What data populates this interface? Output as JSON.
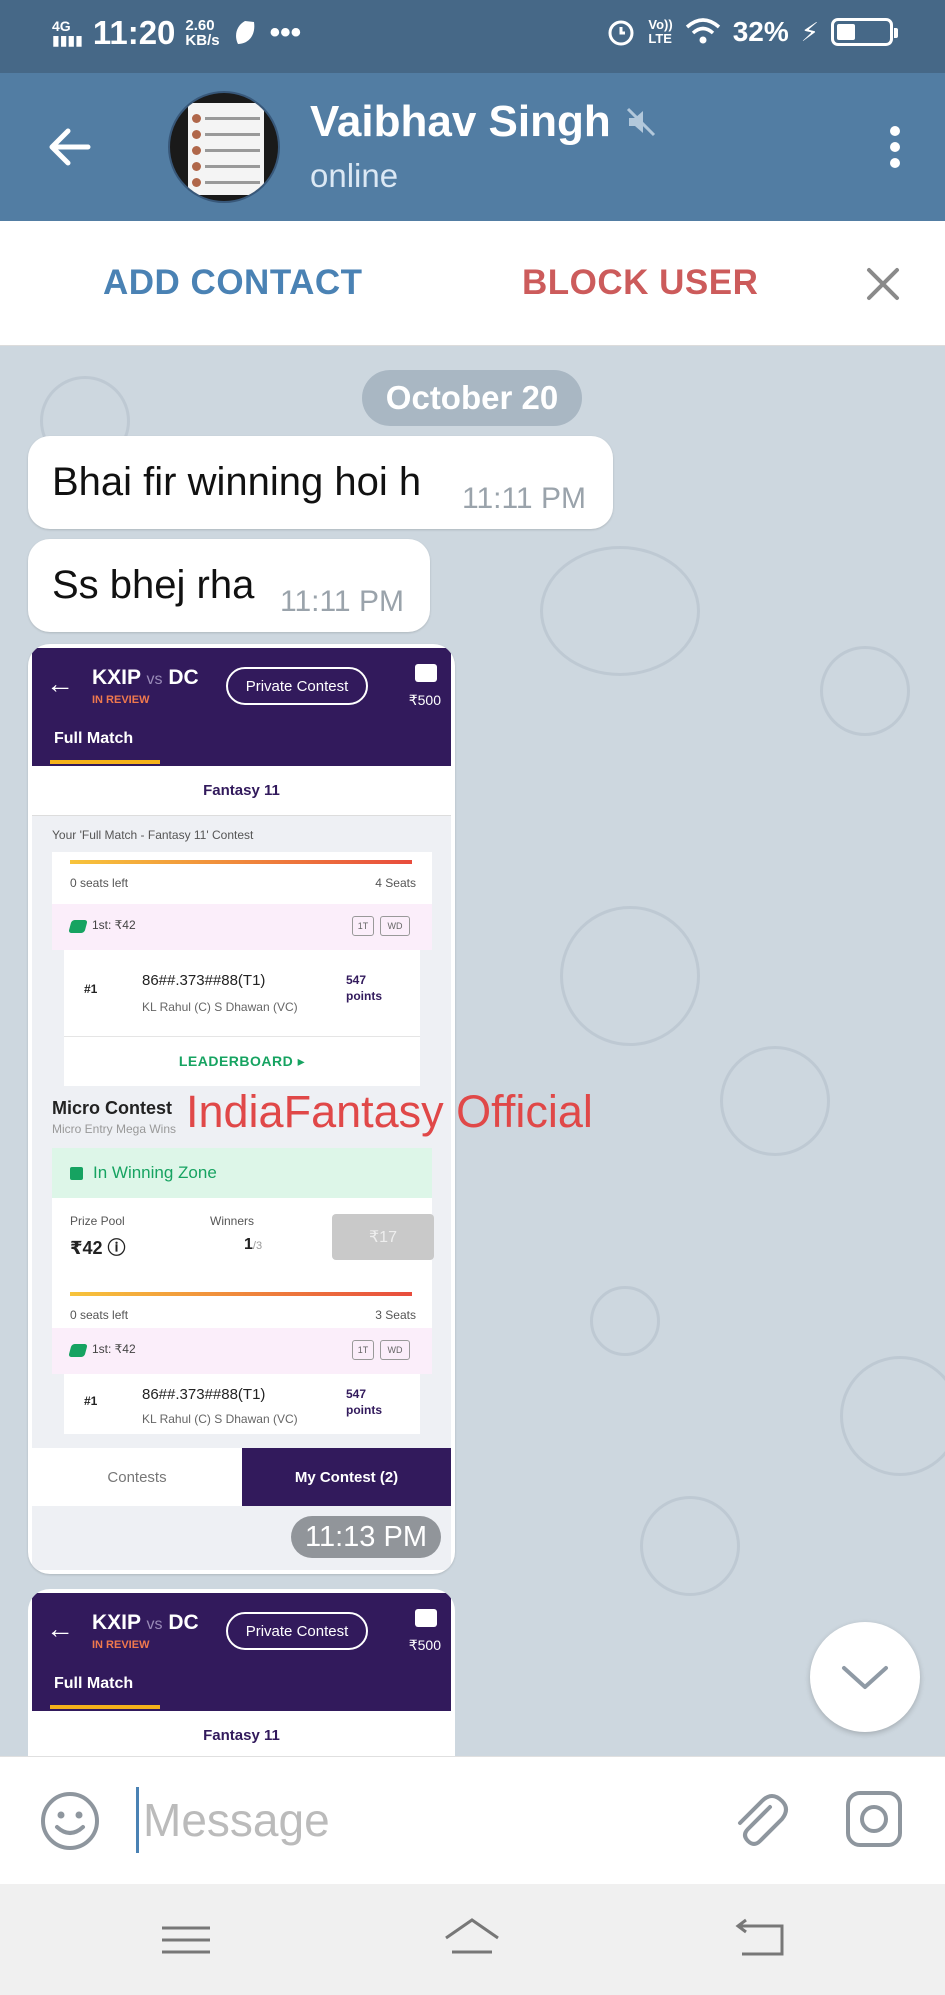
{
  "status_bar": {
    "network": "4G",
    "time": "11:20",
    "speed_value": "2.60",
    "speed_unit": "KB/s",
    "volte_top": "Vo))",
    "volte_bottom": "LTE",
    "battery": "32%",
    "battery_level": 0.32
  },
  "header": {
    "contact_name": "Vaibhav Singh",
    "status": "online"
  },
  "actions": {
    "add_contact": "ADD CONTACT",
    "block_user": "BLOCK USER"
  },
  "chat": {
    "date": "October 20",
    "messages": [
      {
        "text": "Bhai fir winning hoi h",
        "time": "11:11 PM"
      },
      {
        "text": "Ss bhej rha",
        "time": "11:11 PM"
      }
    ],
    "photo_time": "11:13 PM",
    "watermark": "IndiaFantasy Official"
  },
  "screenshot": {
    "match_team1": "KXIP",
    "match_vs": "vs",
    "match_team2": "DC",
    "status": "IN REVIEW",
    "private_contest": "Private Contest",
    "wallet": "₹500",
    "tab": "Full Match",
    "subtab": "Fantasy 11",
    "contest_heading": "Your 'Full Match - Fantasy 11' Contest",
    "seats_left": "0 seats left",
    "seats_total_1": "4 Seats",
    "first_prize": "1st: ₹42",
    "badge_1t": "1T",
    "badge_wd": "WD",
    "rank": "#1",
    "team_id": "86##.373##88(T1)",
    "captains": "KL Rahul (C)     S Dhawan (VC)",
    "points_value": "547",
    "points_label": "points",
    "leaderboard": "LEADERBOARD ▸",
    "micro_title": "Micro Contest",
    "micro_sub": "Micro Entry Mega Wins",
    "winning_zone": "In Winning Zone",
    "prize_pool_label": "Prize Pool",
    "prize_pool_value": "₹42 ⓘ",
    "winners_label": "Winners",
    "winners_value": "1",
    "winners_total": "/3",
    "entry_fee": "₹17",
    "seats_total_2": "3 Seats",
    "tab_contests": "Contests",
    "tab_my_contest": "My Contest (2)"
  },
  "composer": {
    "placeholder": "Message"
  },
  "colors": {
    "header": "#527da3",
    "status_bar": "#466887",
    "add_contact": "#4a82b4",
    "block_user": "#cc5b5b",
    "watermark": "#e04848"
  }
}
